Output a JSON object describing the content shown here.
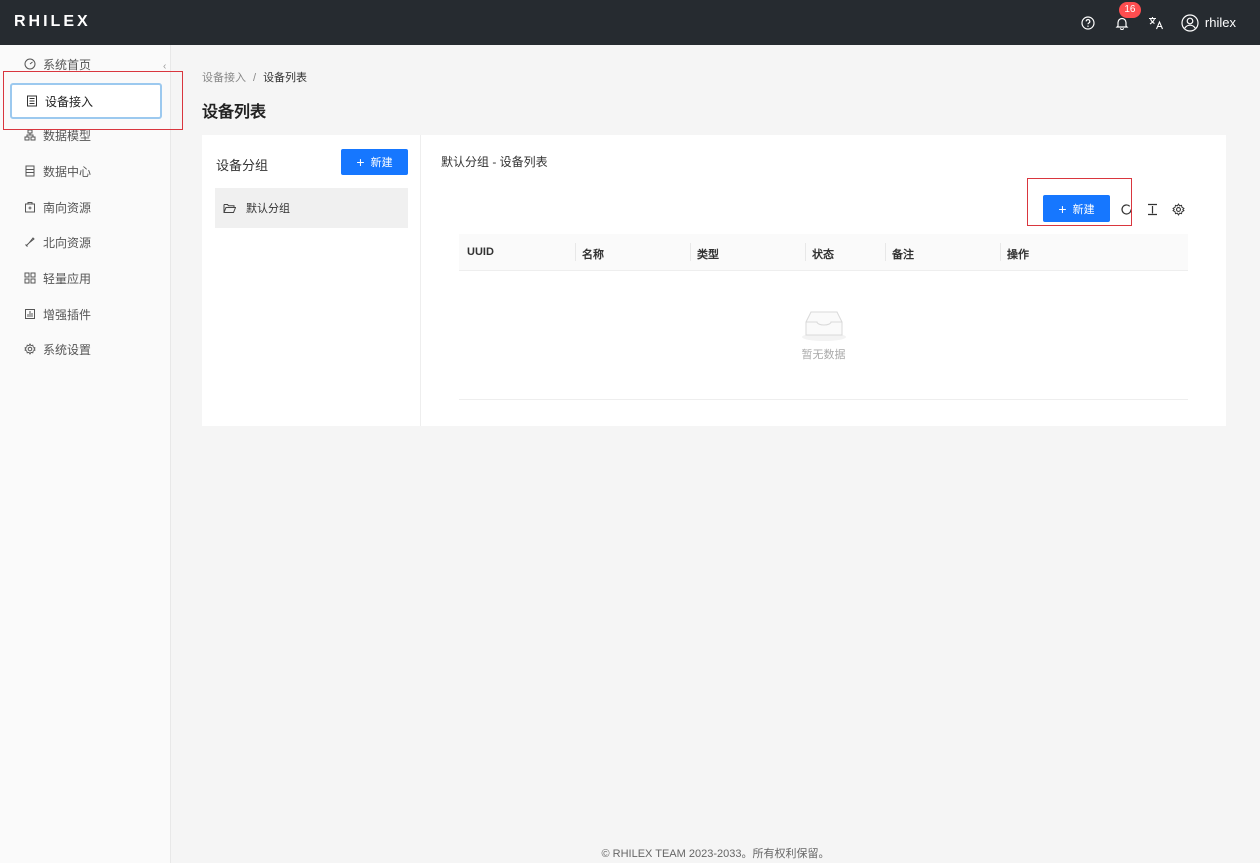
{
  "app": {
    "logo": "RHILEX"
  },
  "header": {
    "notification_count": "16",
    "user_name": "rhilex"
  },
  "sidebar": {
    "collapse_glyph": "‹",
    "items": [
      {
        "label": "系统首页",
        "icon": "dashboard-icon"
      },
      {
        "label": "设备接入",
        "icon": "device-icon",
        "active": true
      },
      {
        "label": "数据模型",
        "icon": "model-icon"
      },
      {
        "label": "数据中心",
        "icon": "database-icon"
      },
      {
        "label": "南向资源",
        "icon": "south-icon"
      },
      {
        "label": "北向资源",
        "icon": "north-icon"
      },
      {
        "label": "轻量应用",
        "icon": "app-icon"
      },
      {
        "label": "增强插件",
        "icon": "plugin-icon"
      },
      {
        "label": "系统设置",
        "icon": "gear-icon"
      }
    ]
  },
  "breadcrumb": {
    "parent": "设备接入",
    "separator": "/",
    "current": "设备列表"
  },
  "page": {
    "title": "设备列表"
  },
  "groups": {
    "title": "设备分组",
    "new_button": "新建",
    "items": [
      {
        "label": "默认分组"
      }
    ]
  },
  "devices": {
    "title": "默认分组 - 设备列表",
    "new_button": "新建",
    "columns": [
      "UUID",
      "名称",
      "类型",
      "状态",
      "备注",
      "操作"
    ],
    "empty_text": "暂无数据"
  },
  "footer": {
    "text": "© RHILEX TEAM 2023-2033。所有权利保留。"
  },
  "colors": {
    "primary": "#1677ff",
    "topbar": "#262b30",
    "badge": "#ff4d4f",
    "highlight": "#d9363e"
  }
}
